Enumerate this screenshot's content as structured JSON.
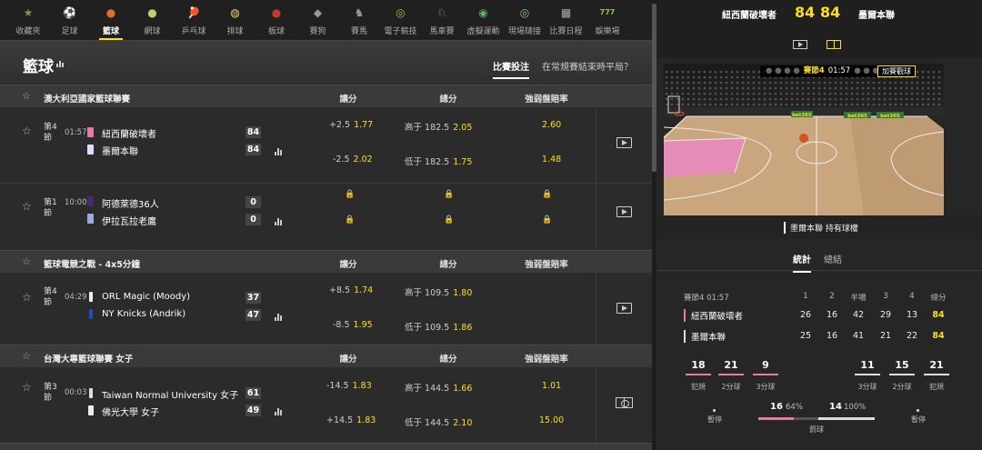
{
  "sports_nav": [
    {
      "label": "收藏夾",
      "icon": "star-icon",
      "glyph": "★",
      "color": "#8a8a5a"
    },
    {
      "label": "足球",
      "icon": "soccer-icon",
      "glyph": "⚽",
      "color": "#ddd"
    },
    {
      "label": "籃球",
      "icon": "basketball-icon",
      "glyph": "●",
      "color": "#e06c2a"
    },
    {
      "label": "網球",
      "icon": "tennis-icon",
      "glyph": "●",
      "color": "#b5d36a"
    },
    {
      "label": "乒乓球",
      "icon": "table-tennis-icon",
      "glyph": "🏓",
      "color": "#e33"
    },
    {
      "label": "排球",
      "icon": "volleyball-icon",
      "glyph": "◍",
      "color": "#e8d46a"
    },
    {
      "label": "板球",
      "icon": "cricket-icon",
      "glyph": "●",
      "color": "#c0392b"
    },
    {
      "label": "賽狗",
      "icon": "greyhound-icon",
      "glyph": "◆",
      "color": "#999"
    },
    {
      "label": "賽馬",
      "icon": "horse-racing-icon",
      "glyph": "♞",
      "color": "#999"
    },
    {
      "label": "電子競技",
      "icon": "esports-icon",
      "glyph": "◎",
      "color": "#8bc34a"
    },
    {
      "label": "馬車賽",
      "icon": "harness-racing-icon",
      "glyph": "♘",
      "color": "#aaa"
    },
    {
      "label": "虛擬運動",
      "icon": "virtual-sports-icon",
      "glyph": "◉",
      "color": "#5fae6b"
    },
    {
      "label": "現場鏈接",
      "icon": "live-link-icon",
      "glyph": "◎",
      "color": "#7fc57f"
    },
    {
      "label": "比賽日程",
      "icon": "calendar-icon",
      "glyph": "▦",
      "color": "#aaa"
    },
    {
      "label": "娛樂場",
      "icon": "casino-icon",
      "glyph": "777",
      "color": "#8bc34a"
    }
  ],
  "active_sport": "籃球",
  "header": {
    "title": "籃球",
    "tab_active": "比賽投注",
    "tab_other": "在常規賽結束時平局？"
  },
  "columns": {
    "spread": "讓分",
    "total": "總分",
    "moneyline": "強弱盤賠率"
  },
  "leagues": [
    {
      "name": "澳大利亞國家籃球聯賽",
      "match": {
        "period": [
          "第4",
          "節"
        ],
        "clock": "01:57",
        "home": {
          "name": "紐西蘭破壞者",
          "score": "84",
          "jersey": "#e879a8"
        },
        "away": {
          "name": "墨爾本聯",
          "score": "84",
          "jersey": "#dcdcff"
        },
        "spread": [
          {
            "h": "+2.5",
            "v": "1.77"
          },
          {
            "h": "-2.5",
            "v": "2.02"
          }
        ],
        "total": [
          {
            "h": "高于 182.5",
            "v": "2.05"
          },
          {
            "h": "低于 182.5",
            "v": "1.75"
          }
        ],
        "moneyline": [
          "2.60",
          "1.48"
        ]
      }
    },
    {
      "name": "",
      "match": {
        "period": [
          "第1",
          "節"
        ],
        "clock": "10:00",
        "home": {
          "name": "阿德萊德36人",
          "score": "0",
          "jersey": "#4a2a6a"
        },
        "away": {
          "name": "伊拉瓦拉老鷹",
          "score": "0",
          "jersey": "#9aaae0"
        }
      }
    },
    {
      "name": "籃球電競之戰 - 4x5分鐘",
      "match": {
        "period": [
          "第4",
          "節"
        ],
        "clock": "04:29",
        "home": {
          "name": "ORL Magic (Moody)",
          "score": "37",
          "jersey": "#eee"
        },
        "away": {
          "name": "NY Knicks (Andrik)",
          "score": "47",
          "jersey": "#1e4bbf"
        },
        "spread": [
          {
            "h": "+8.5",
            "v": "1.74"
          },
          {
            "h": "-8.5",
            "v": "1.95"
          }
        ],
        "total": [
          {
            "h": "高于 109.5",
            "v": "1.80"
          },
          {
            "h": "低于 109.5",
            "v": "1.86"
          }
        ]
      }
    },
    {
      "name": "台灣大專籃球聯賽 女子",
      "match": {
        "period": [
          "第3",
          "節"
        ],
        "clock": "00:03",
        "home": {
          "name": "Taiwan Normal University 女子",
          "score": "61",
          "jersey": "#ddd"
        },
        "away": {
          "name": "佛光大學 女子",
          "score": "49",
          "jersey": "#eee"
        },
        "spread": [
          {
            "h": "-14.5",
            "v": "1.83"
          },
          {
            "h": "+14.5",
            "v": "1.83"
          }
        ],
        "total": [
          {
            "h": "高于 144.5",
            "v": "1.66"
          },
          {
            "h": "低于 144.5",
            "v": "2.10"
          }
        ],
        "moneyline": [
          "1.01",
          "15.00"
        ]
      }
    }
  ],
  "right_panel": {
    "home": "紐西蘭破壞者",
    "away": "墨爾本聯",
    "home_score": "84",
    "away_score": "84",
    "banner_period": "賽節4",
    "banner_clock": "01:57",
    "bet_button": "加賽觀球",
    "ad_text": "bet365",
    "possession": "墨爾本聯  持有球權",
    "tab_stats": "統計",
    "tab_summary": "總結",
    "stats": {
      "period_label": "賽節4 01:57",
      "headers": [
        "1",
        "2",
        "半場",
        "3",
        "4",
        "總分"
      ],
      "home_row": [
        "26",
        "16",
        "42",
        "29",
        "13",
        "84"
      ],
      "away_row": [
        "25",
        "16",
        "41",
        "21",
        "22",
        "84"
      ]
    },
    "home_boxes": [
      {
        "v": "18",
        "l": "犯規"
      },
      {
        "v": "21",
        "l": "2分球"
      },
      {
        "v": "9",
        "l": "3分球"
      }
    ],
    "away_boxes": [
      {
        "v": "11",
        "l": "3分球"
      },
      {
        "v": "15",
        "l": "2分球"
      },
      {
        "v": "21",
        "l": "犯規"
      }
    ],
    "timeout_label": "暫停",
    "ft": {
      "home": "16",
      "home_pct": "64%",
      "away": "14",
      "away_pct": "100%",
      "label": "罰球",
      "home_frac": 0.64,
      "away_frac": 1.0
    }
  }
}
